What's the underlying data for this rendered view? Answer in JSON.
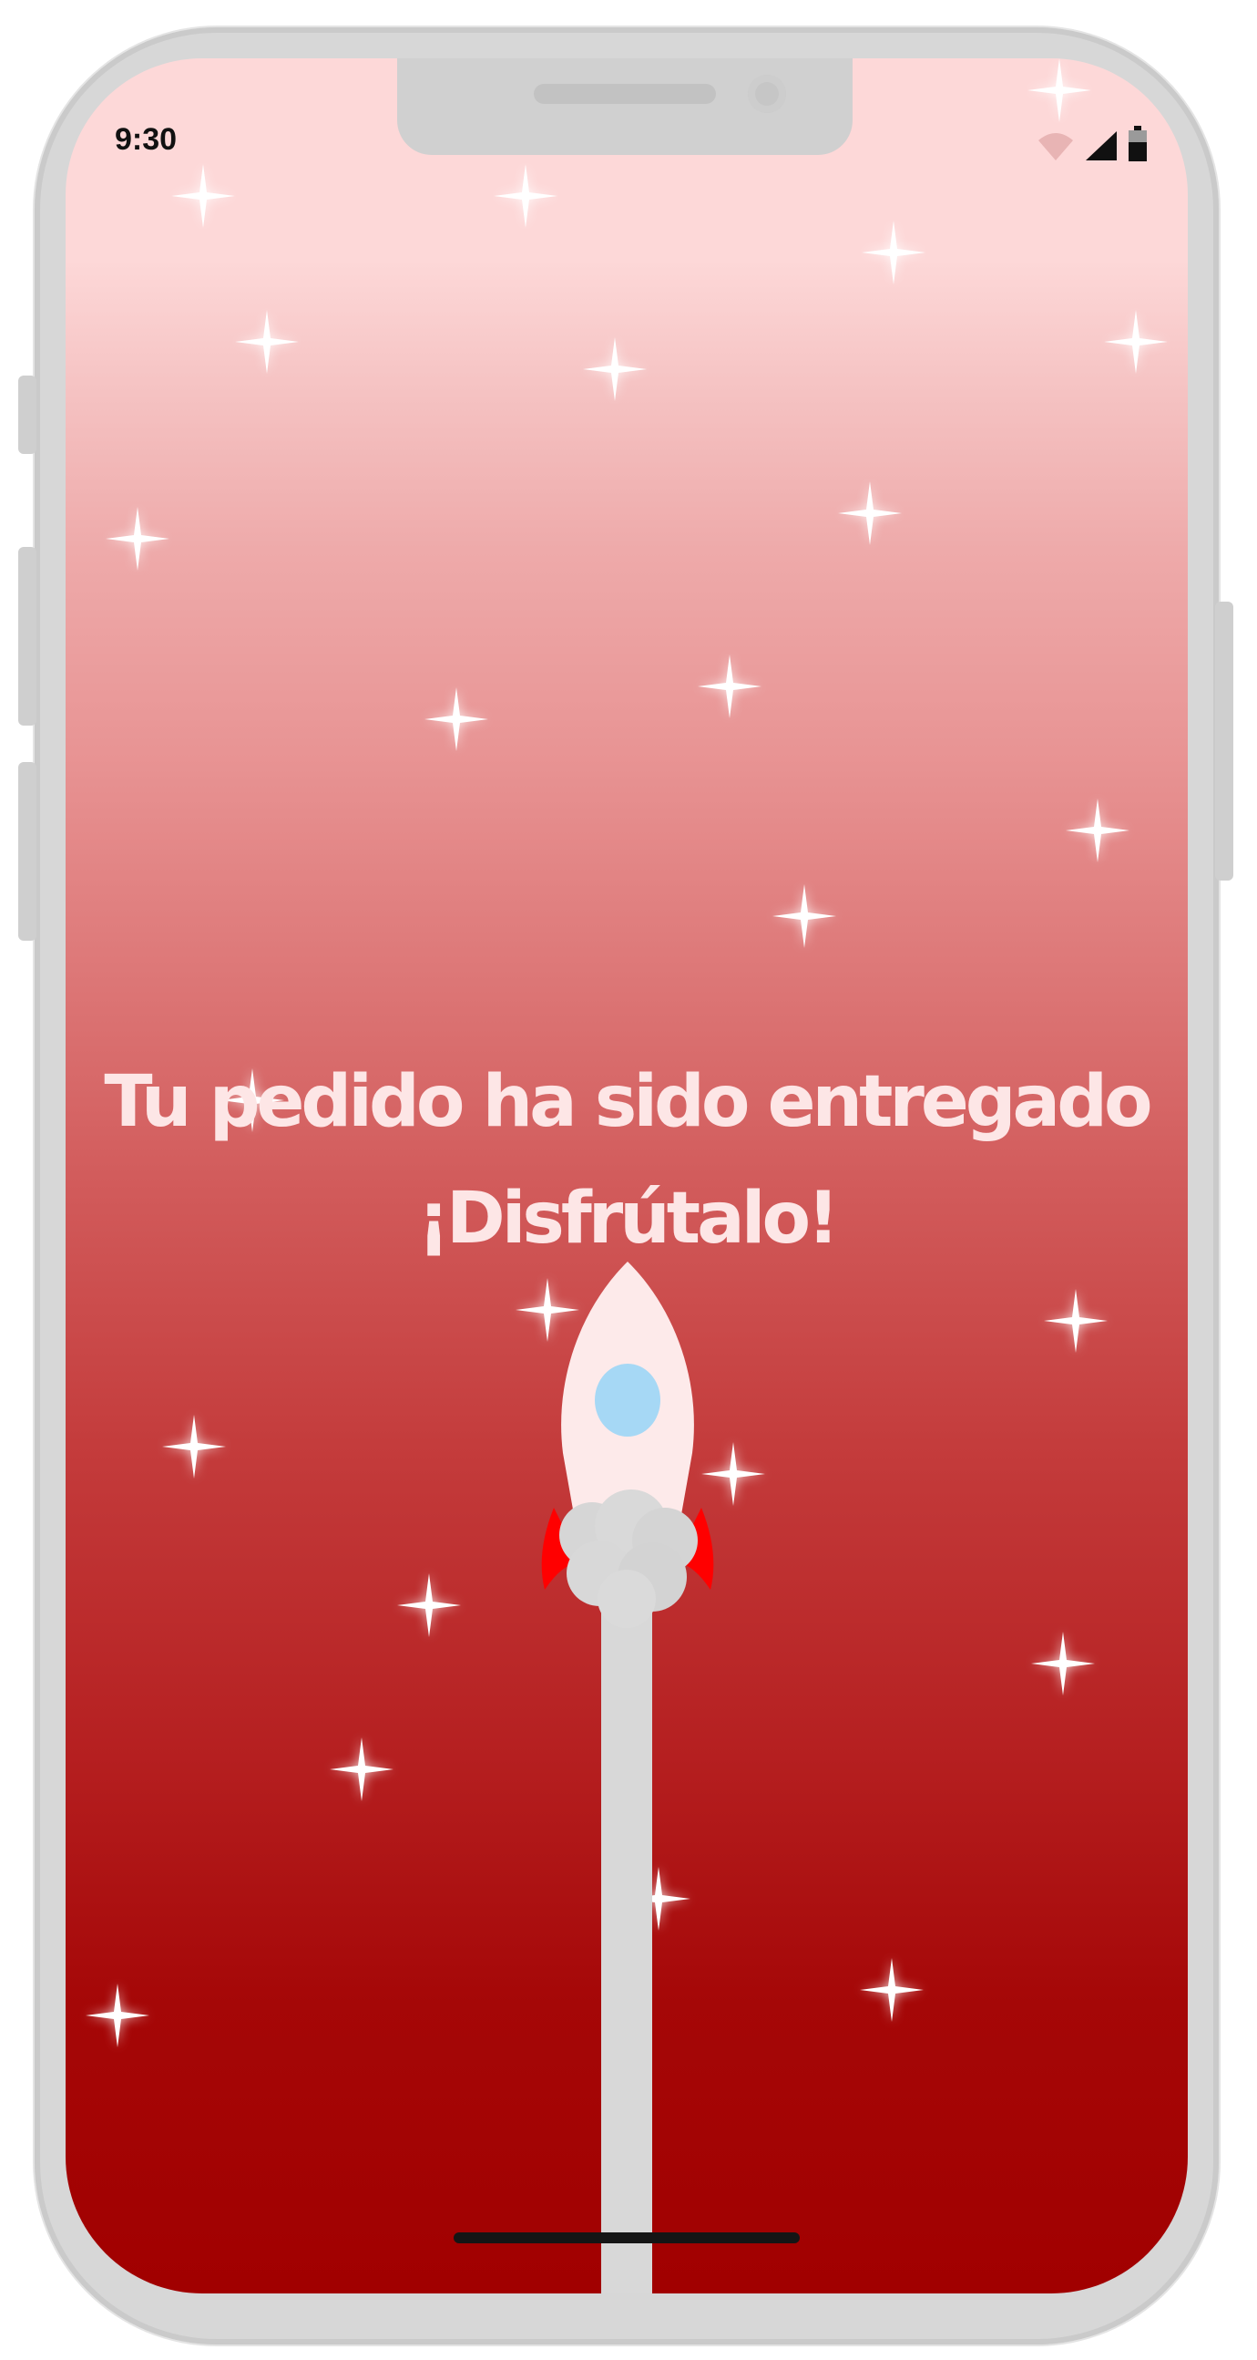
{
  "status_bar": {
    "time": "9:30",
    "icons": [
      "wifi-icon",
      "signal-icon",
      "battery-icon"
    ]
  },
  "message": {
    "line1": "Tu pedido ha sido entregado",
    "line2": "¡Disfrútalo!"
  },
  "colors": {
    "gradient_top": "#fdd8d8",
    "gradient_bottom": "#a10000",
    "text": "#fde6e6",
    "rocket_body": "#fdeaea",
    "rocket_window": "#a6d8f5",
    "rocket_fins": "#ff0000",
    "smoke": "#d8d8d8"
  },
  "illustration": {
    "icon": "rocket-icon"
  }
}
